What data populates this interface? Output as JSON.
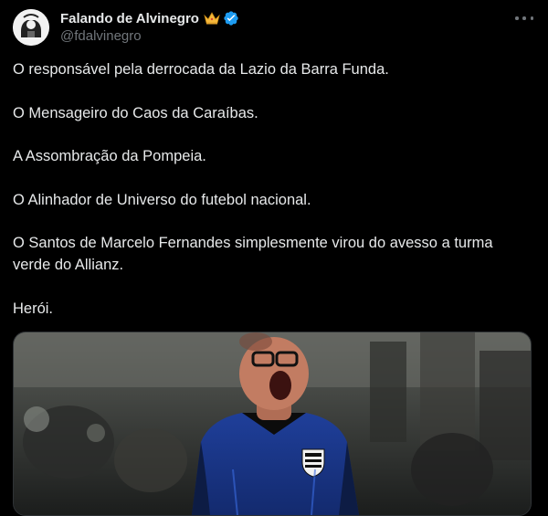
{
  "account": {
    "display_name": "Falando de Alvinegro",
    "handle": "@fdalvinegro",
    "badges": [
      "crown-icon",
      "verified-icon"
    ]
  },
  "tweet": {
    "paragraphs": [
      "O responsável pela derrocada da Lazio da Barra Funda.",
      "O Mensageiro do Caos da Caraíbas.",
      "A Assombração da Pompeia.",
      "O Alinhador de Universo do futebol nacional.",
      "O Santos de Marcelo Fernandes simplesmente virou do avesso a turma verde do Allianz.",
      "Herói."
    ]
  },
  "media": {
    "icon": "photo-image",
    "description_icon": "santos-crest-icon"
  },
  "colors": {
    "background": "#000000",
    "text": "#e7e9ea",
    "muted": "#71767b",
    "verified": "#1d9bf0",
    "crown": "#f6b93b"
  }
}
